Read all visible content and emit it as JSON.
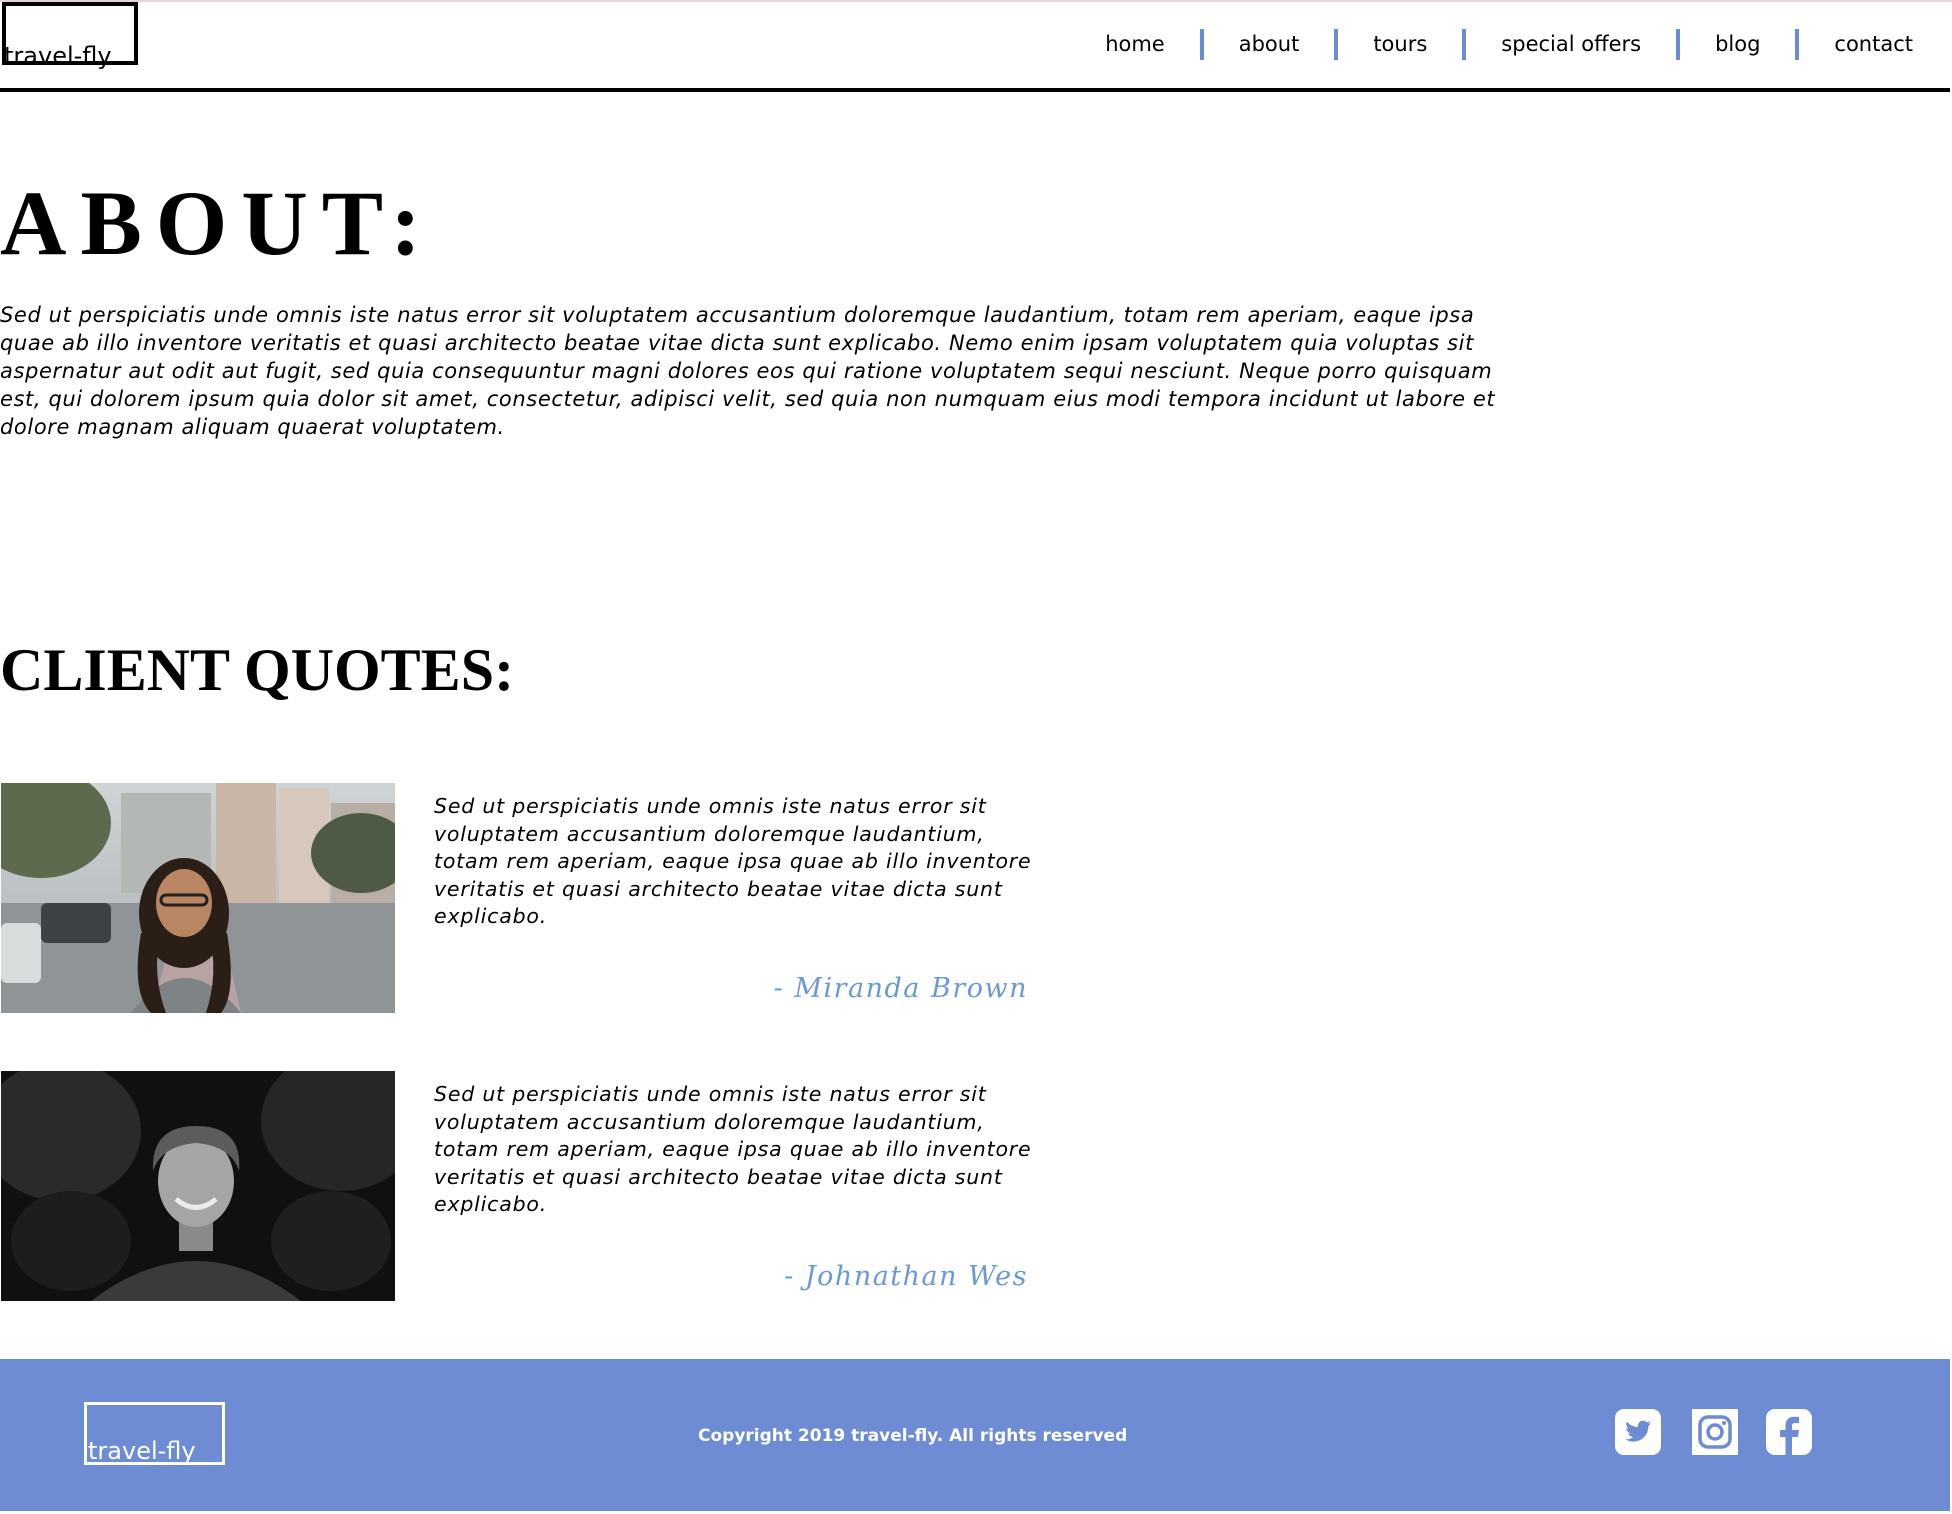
{
  "header": {
    "logo": "travel-fly",
    "nav": [
      {
        "label": "home"
      },
      {
        "label": "about"
      },
      {
        "label": "tours"
      },
      {
        "label": "special offers"
      },
      {
        "label": "blog"
      },
      {
        "label": "contact"
      }
    ]
  },
  "about": {
    "title": "ABOUT:",
    "text": "Sed ut perspiciatis unde omnis iste natus error sit voluptatem accusantium doloremque laudantium, totam rem aperiam, eaque ipsa quae ab illo inventore veritatis et quasi architecto beatae vitae dicta sunt explicabo. Nemo enim ipsam voluptatem quia voluptas sit aspernatur aut odit aut fugit, sed quia consequuntur magni dolores eos qui ratione voluptatem sequi nesciunt. Neque porro quisquam est, qui dolorem ipsum quia dolor sit amet, consectetur, adipisci velit, sed quia non numquam eius modi tempora incidunt ut labore et dolore magnam aliquam quaerat voluptatem."
  },
  "quotes": {
    "title": "CLIENT QUOTES:",
    "items": [
      {
        "text": "Sed ut perspiciatis unde omnis iste natus error sit voluptatem accusantium doloremque laudantium, totam rem aperiam, eaque ipsa quae ab illo inventore veritatis et quasi architecto beatae vitae dicta sunt explicabo.",
        "author": "- Miranda Brown"
      },
      {
        "text": "Sed ut perspiciatis unde omnis iste natus error sit voluptatem accusantium doloremque laudantium, totam rem aperiam, eaque ipsa quae ab illo inventore veritatis et quasi architecto beatae vitae dicta sunt explicabo.",
        "author": "- Johnathan Wes"
      }
    ]
  },
  "footer": {
    "logo": "travel-fly",
    "copyright": "Copyright 2019 travel-fly. All rights reserved",
    "social": [
      "twitter-icon",
      "instagram-icon",
      "facebook-icon"
    ]
  },
  "colors": {
    "accent": "#6e8cd4",
    "separator": "#6b8bd3",
    "author": "#6b98d6"
  }
}
